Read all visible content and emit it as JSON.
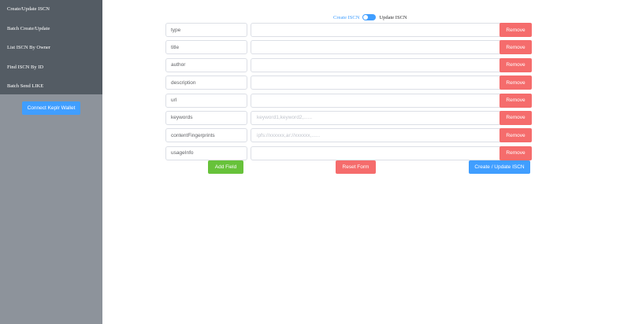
{
  "sidebar": {
    "items": [
      {
        "label": "Create/Update ISCN"
      },
      {
        "label": "Batch Create/Update"
      },
      {
        "label": "List ISCN By Owner"
      },
      {
        "label": "Find ISCN By ID"
      },
      {
        "label": "Batch Send LIKE"
      }
    ],
    "connect_label": "Connect Keplr Wallet"
  },
  "mode": {
    "left_label": "Create ISCN",
    "right_label": "Update ISCN"
  },
  "fields": [
    {
      "key": "type",
      "value": "",
      "placeholder": ""
    },
    {
      "key": "title",
      "value": "",
      "placeholder": ""
    },
    {
      "key": "author",
      "value": "",
      "placeholder": ""
    },
    {
      "key": "description",
      "value": "",
      "placeholder": ""
    },
    {
      "key": "url",
      "value": "",
      "placeholder": ""
    },
    {
      "key": "keywords",
      "value": "",
      "placeholder": "keyword1,keyword2,......"
    },
    {
      "key": "contentFingerprints",
      "value": "",
      "placeholder": "ipfs://xxxxxx,ar://xxxxxx,......"
    },
    {
      "key": "usageInfo",
      "value": "",
      "placeholder": ""
    }
  ],
  "remove_label": "Remove",
  "actions": {
    "add_label": "Add Field",
    "reset_label": "Reset Form",
    "submit_label": "Create / Update ISCN"
  },
  "colors": {
    "primary": "#409eff",
    "danger": "#f56c6c",
    "success": "#67c23a",
    "sidebar_menu": "#545c64",
    "sidebar_bg": "#8d939b"
  }
}
